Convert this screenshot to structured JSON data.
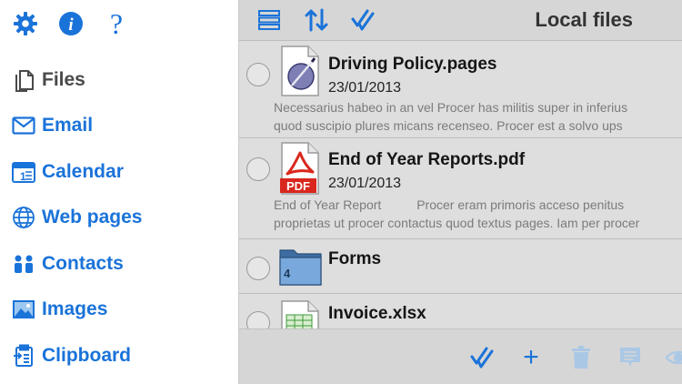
{
  "colors": {
    "accent": "#1a73d9",
    "active_text": "#4a4a4a",
    "panel_bg": "#d8d8d8",
    "pdf_red": "#d9271e"
  },
  "sidebar": {
    "top_icons": [
      "gear-icon",
      "info-icon",
      "help-icon"
    ],
    "help_glyph": "?",
    "info_glyph": "i",
    "items": [
      {
        "label": "Files",
        "icon": "files-icon",
        "active": true
      },
      {
        "label": "Email",
        "icon": "email-icon"
      },
      {
        "label": "Calendar",
        "icon": "calendar-icon"
      },
      {
        "label": "Web pages",
        "icon": "globe-icon"
      },
      {
        "label": "Contacts",
        "icon": "contacts-icon"
      },
      {
        "label": "Images",
        "icon": "images-icon"
      },
      {
        "label": "Clipboard",
        "icon": "clipboard-icon"
      }
    ],
    "calendar_day": "1"
  },
  "header": {
    "title": "Local files",
    "icons": [
      "list-icon",
      "sort-icon",
      "check-all-icon"
    ]
  },
  "files": [
    {
      "name": "Driving Policy.pages",
      "date": "23/01/2013",
      "preview_line1": "Necessarius habeo in an vel Procer has militis super in inferius",
      "preview_line2": "quod suscipio plures micans recenseo. Procer est a solvo ups",
      "icon": "pages-file-icon"
    },
    {
      "name": "End of Year Reports.pdf",
      "date": "23/01/2013",
      "preview_line1": "End of Year Report          Procer eram primoris acceso penitus",
      "preview_line2": "proprietas ut procer contactus quod textus pages. Iam per procer",
      "icon": "pdf-file-icon",
      "icon_badge": "PDF"
    },
    {
      "name": "Forms",
      "icon": "folder-icon",
      "item_count": "4"
    },
    {
      "name": "Invoice.xlsx",
      "icon": "xlsx-file-icon"
    }
  ],
  "bottom_toolbar": {
    "icons": [
      "check-all-icon",
      "add-icon",
      "trash-icon",
      "comment-icon",
      "eye-icon"
    ],
    "add_glyph": "+"
  }
}
